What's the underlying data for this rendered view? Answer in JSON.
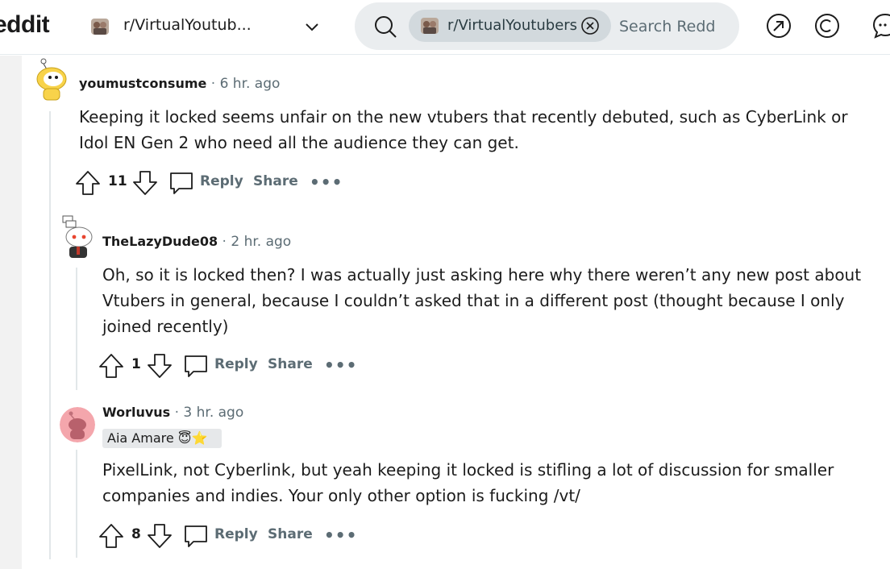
{
  "header": {
    "logo_text": "eddit",
    "community": "r/VirtualYoutub...",
    "search_chip": "r/VirtualYoutubers",
    "search_placeholder": "Search Redd",
    "icons": [
      "search-icon",
      "close-circle-icon",
      "popular-arrow-icon",
      "copyright-icon",
      "chat-bubble-icon"
    ]
  },
  "comments": [
    {
      "author": "youmustconsume",
      "time": "6 hr. ago",
      "body_lines": [
        "Keeping it locked seems unfair on the new vtubers that recently debuted, such as CyberLink or",
        "Idol EN Gen 2 who need all the audience they can get."
      ],
      "score": "11",
      "reply": "Reply",
      "share": "Share",
      "more": "•••"
    },
    {
      "author": "TheLazyDude08",
      "time": "2 hr. ago",
      "body_lines": [
        "Oh, so it is locked then? I was actually just asking here why there weren’t any new post about",
        "Vtubers in general, because I couldn’t asked that in a different post (thought because I only",
        "joined recently)"
      ],
      "score": "1",
      "reply": "Reply",
      "share": "Share",
      "more": "•••"
    },
    {
      "author": "Worluvus",
      "time": "3 hr. ago",
      "flair": "Aia Amare 😇⭐",
      "body_lines": [
        "PixelLink, not Cyberlink, but yeah keeping it locked is stifling a lot of discussion for smaller",
        "companies and indies. Your only other option is fucking /vt/"
      ],
      "score": "8",
      "reply": "Reply",
      "share": "Share",
      "more": "•••"
    }
  ],
  "separator": "·",
  "colors": {
    "meta_gray": "#5c6c74",
    "search_bg": "#eaedef",
    "chip_bg": "#d2d9dd",
    "thread_line": "#e2e7e9",
    "worluvus_avatar": "#f4a6ac"
  }
}
